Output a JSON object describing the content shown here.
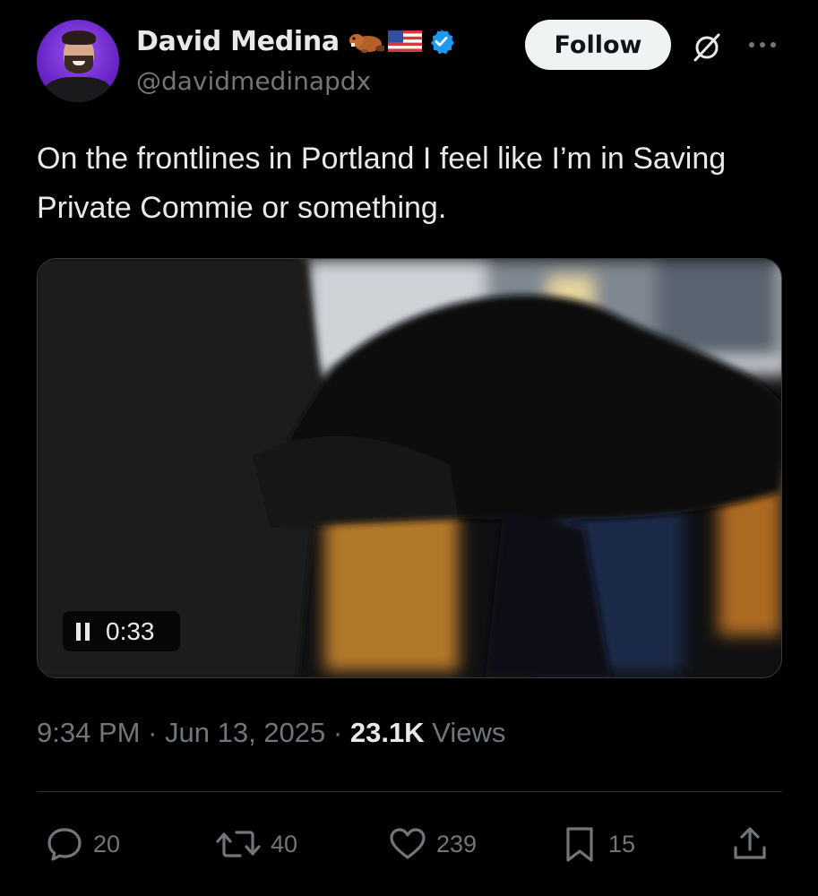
{
  "author": {
    "name": "David Medina",
    "handle": "@davidmedinapdx",
    "emoji": [
      "beaver",
      "us-flag"
    ],
    "verified": true
  },
  "follow_label": "Follow",
  "tweet": {
    "text": "On the frontlines in Portland I feel like I’m in Saving Private Commie or something."
  },
  "video": {
    "state": "playing",
    "duration": "0:33"
  },
  "meta": {
    "time": "9:34 PM",
    "separator": "·",
    "date": "Jun 13, 2025",
    "views_count": "23.1K",
    "views_label": "Views"
  },
  "actions": {
    "replies": "20",
    "reposts": "40",
    "likes": "239",
    "bookmarks": "15"
  },
  "colors": {
    "background": "#000000",
    "text": "#e7e9ea",
    "secondary": "#71767b",
    "verified": "#1d9bf0",
    "follow_bg": "#eff3f4"
  }
}
